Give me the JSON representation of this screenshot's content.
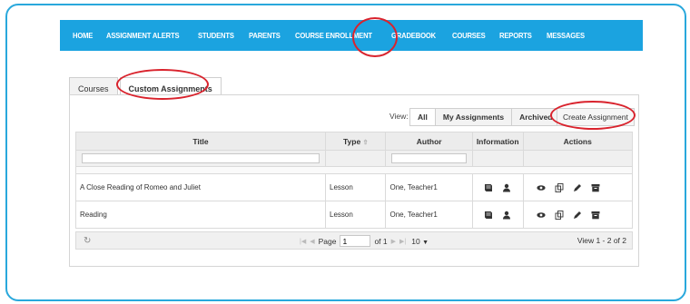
{
  "nav": {
    "items": [
      "HOME",
      "ASSIGNMENT ALERTS",
      "STUDENTS",
      "PARENTS",
      "COURSE ENROLLMENT",
      "GRADEBOOK",
      "COURSES",
      "REPORTS",
      "MESSAGES"
    ],
    "active": "COURSES"
  },
  "tabs": {
    "courses": "Courses",
    "custom": "Custom Assignments"
  },
  "view": {
    "label": "View:",
    "all": "All",
    "mine": "My Assignments",
    "archived": "Archived",
    "create": "Create Assignment"
  },
  "table": {
    "headers": {
      "title": "Title",
      "type": "Type",
      "author": "Author",
      "information": "Information",
      "actions": "Actions"
    },
    "rows": [
      {
        "title": "A Close Reading of Romeo and Juliet",
        "type": "Lesson",
        "author": "One, Teacher1"
      },
      {
        "title": "Reading",
        "type": "Lesson",
        "author": "One, Teacher1"
      }
    ]
  },
  "pager": {
    "page_label": "Page",
    "page_value": "1",
    "of_label": "of 1",
    "rows_value": "10",
    "summary": "View 1 - 2 of 2"
  },
  "colors": {
    "nav_bg": "#1ba3e0",
    "frame": "#29a8dc",
    "annotation": "#d9232d"
  },
  "icons": {
    "sort": "sort-up-icon",
    "info": [
      "book-icon",
      "user-icon"
    ],
    "actions": [
      "eye-icon",
      "copy-icon",
      "pencil-icon",
      "archive-icon"
    ],
    "refresh": "refresh-icon"
  }
}
